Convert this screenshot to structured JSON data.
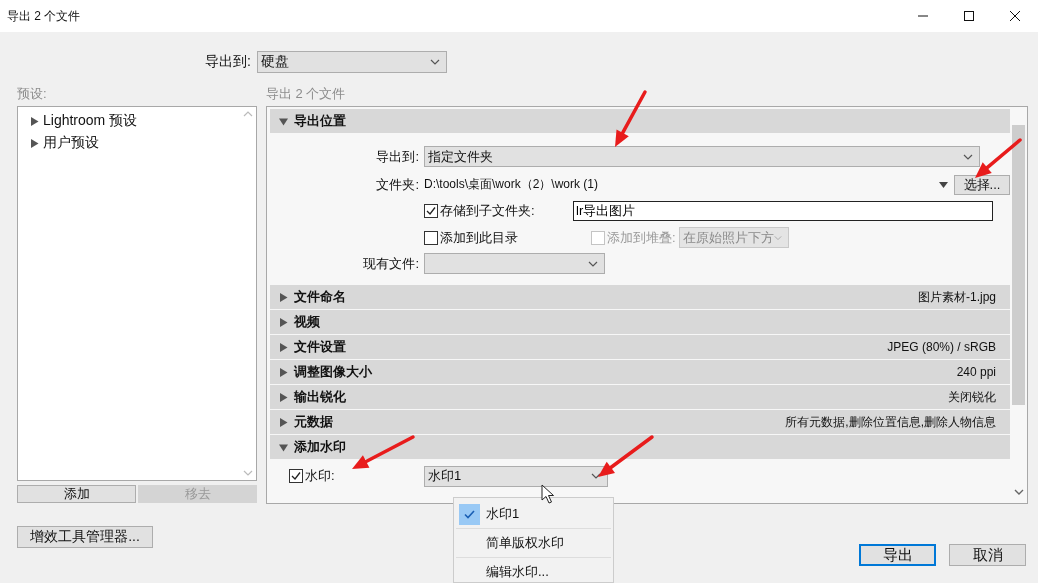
{
  "window": {
    "title": "导出 2 个文件"
  },
  "export_to": {
    "label": "导出到:",
    "value": "硬盘"
  },
  "presets": {
    "label": "预设:",
    "items": [
      {
        "label": "Lightroom 预设",
        "expanded": false
      },
      {
        "label": "用户预设",
        "expanded": false
      }
    ],
    "buttons": [
      {
        "label": "添加",
        "disabled": false
      },
      {
        "label": "移去",
        "disabled": true
      }
    ]
  },
  "plugin_button": "增效工具管理器...",
  "panel": {
    "label": "导出 2 个文件",
    "sections": [
      {
        "kind": "location",
        "title": "导出位置",
        "expanded": true,
        "export_to_label": "导出到:",
        "export_to_value": "指定文件夹",
        "folder_label": "文件夹:",
        "folder_path": "D:\\tools\\桌面\\work（2）\\work (1)",
        "choose_button": "选择...",
        "subfolder": {
          "label": "存储到子文件夹:",
          "checked": true,
          "value": "lr导出图片"
        },
        "add_catalog": {
          "label": "添加到此目录",
          "checked": false
        },
        "add_stack": {
          "label": "添加到堆叠:",
          "checked": false,
          "disabled": true,
          "value": "在原始照片下方"
        },
        "existing_label": "现有文件:"
      },
      {
        "kind": "summary",
        "title": "文件命名",
        "expanded": false,
        "summary": "图片素材-1.jpg"
      },
      {
        "kind": "summary",
        "title": "视频",
        "expanded": false
      },
      {
        "kind": "summary",
        "title": "文件设置",
        "expanded": false,
        "summary": "JPEG (80%) / sRGB"
      },
      {
        "kind": "summary",
        "title": "调整图像大小",
        "expanded": false,
        "summary": "240 ppi"
      },
      {
        "kind": "summary",
        "title": "输出锐化",
        "expanded": false,
        "summary": "关闭锐化"
      },
      {
        "kind": "summary",
        "title": "元数据",
        "expanded": false,
        "summary": "所有元数据,删除位置信息,删除人物信息"
      },
      {
        "kind": "watermark",
        "title": "添加水印",
        "expanded": true,
        "label": "水印:",
        "checked": true,
        "value": "水印1",
        "menu": [
          {
            "label": "水印1",
            "selected": true
          },
          {
            "label": "简单版权水印",
            "selected": false
          },
          {
            "label": "编辑水印...",
            "selected": false
          }
        ]
      }
    ]
  },
  "buttons": [
    {
      "label": "导出",
      "focused": true
    },
    {
      "label": "取消",
      "focused": false
    }
  ]
}
